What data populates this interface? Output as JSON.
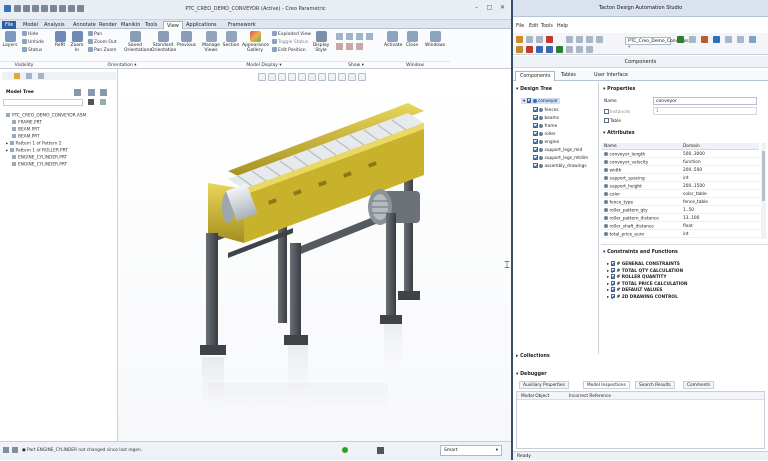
{
  "creo": {
    "title": "PTC_CREO_DEMO_CONVEYOR (Active) - Creo Parametric",
    "ribbon_tabs": [
      {
        "label": "File",
        "active": false
      },
      {
        "label": "Model",
        "active": false
      },
      {
        "label": "Analysis",
        "active": false
      },
      {
        "label": "Annotate",
        "active": false
      },
      {
        "label": "Render",
        "active": false
      },
      {
        "label": "Manikin",
        "active": false
      },
      {
        "label": "Tools",
        "active": false
      },
      {
        "label": "View",
        "active": true
      },
      {
        "label": "Applications",
        "active": false
      },
      {
        "label": "Framework",
        "active": false
      }
    ],
    "ribbon": {
      "layers": "Layers",
      "hide": "Hide",
      "unhide": "Unhide",
      "status": "Status",
      "refit": "Refit",
      "zoom_in": "Zoom In",
      "pan": "Pan",
      "zoom_out": "Zoom Out",
      "pan_zoom": "Pan Zoom",
      "saved_orientations": "Saved Orientations",
      "standard_orientation": "Standard Orientation",
      "previous": "Previous",
      "manage_views": "Manage Views",
      "section": "Section",
      "appearance_gallery": "Appearance Gallery",
      "exploded_view": "Exploded View",
      "toggle_status": "Toggle Status",
      "edit_position": "Edit Position",
      "display_style": "Display Style",
      "activate": "Activate",
      "close": "Close",
      "windows": "Windows",
      "groups": {
        "visibility": "Visibility",
        "orientation": "Orientation ▾",
        "model_display": "Model Display ▾",
        "show": "Show ▾",
        "window": "Window"
      }
    },
    "model_tree": {
      "title": "Model Tree",
      "items": [
        {
          "label": "PTC_CREO_DEMO_CONVEYOR.ASM",
          "expand": ""
        },
        {
          "label": "FRAME.PRT",
          "expand": ""
        },
        {
          "label": "BEAM.PRT",
          "expand": ""
        },
        {
          "label": "BEAM.PRT",
          "expand": ""
        },
        {
          "label": "Pattern 1 of Pattern 2",
          "expand": "▸"
        },
        {
          "label": "Pattern 1 of ROLLER.PRT",
          "expand": "▸"
        },
        {
          "label": "ENGINE_CYLINDER.PRT",
          "expand": ""
        },
        {
          "label": "ENGINE_CYLINDER.PRT",
          "expand": ""
        }
      ]
    },
    "status_message": "● Part ENGINE_CYLINDER not changed since last regen.",
    "filter_value": "Smart"
  },
  "tacton": {
    "title": "Tacton Design Automation Studio",
    "menu": [
      "File",
      "Edit",
      "Tools",
      "Help"
    ],
    "file_name": "PTC_Creo_Demo_Conveyor.tcx *",
    "subheader": "Components",
    "tabs": [
      {
        "label": "Components",
        "active": true
      },
      {
        "label": "Tables",
        "active": false
      },
      {
        "label": "User Interface",
        "active": false
      }
    ],
    "design_tree": {
      "title": "Design Tree",
      "root": "conveyor",
      "children": [
        "fences",
        "beams",
        "frame",
        "roller",
        "engine",
        "support_legs_mid",
        "support_legs_mtdim",
        "assembly_drawings"
      ]
    },
    "collections": "Collections",
    "properties": {
      "title": "Properties",
      "name_label": "Name",
      "name_value": "conveyor",
      "instances_label": "Instances",
      "instances_value": "1",
      "table_label": "Table"
    },
    "attributes": {
      "title": "Attributes",
      "col_name": "Name",
      "col_domain": "Domain",
      "rows": [
        {
          "name": "conveyor_length",
          "domain": "500..3000"
        },
        {
          "name": "conveyor_velocity",
          "domain": "function"
        },
        {
          "name": "width",
          "domain": "200..500"
        },
        {
          "name": "support_spacing",
          "domain": "int"
        },
        {
          "name": "support_height",
          "domain": "200..1500"
        },
        {
          "name": "color",
          "domain": "color_table"
        },
        {
          "name": "fence_type",
          "domain": "fence_table"
        },
        {
          "name": "roller_pattern_qty",
          "domain": "1..50"
        },
        {
          "name": "roller_pattern_distance",
          "domain": "13..100"
        },
        {
          "name": "roller_shaft_distance",
          "domain": "float"
        },
        {
          "name": "total_price_euro",
          "domain": "int"
        }
      ]
    },
    "constraints": {
      "title": "Constraints and Functions",
      "items": [
        "# GENERAL CONSTRAINTS",
        "# TOTAL QTY CALCULATION",
        "# ROLLER QUANTITY",
        "# TOTAL PRICE CALCULATION",
        "# DEFAULT VALUES",
        "# 2D DRAWING CONTROL"
      ]
    },
    "debugger": {
      "title": "Debugger",
      "tabs": [
        {
          "label": "Auxiliary Properties",
          "active": false
        },
        {
          "label": "Model Inspections",
          "active": true
        },
        {
          "label": "Search Results",
          "active": false
        },
        {
          "label": "Comments",
          "active": false
        }
      ],
      "col_object": "Model Object",
      "col_reference": "Incorrect Reference"
    },
    "status": "Ready"
  },
  "colors": {
    "frame_dark": "#4a4e53",
    "frame_yellow": "#d7c23d",
    "roller": "#dfe3e6",
    "accent": "#1f6fd1"
  }
}
